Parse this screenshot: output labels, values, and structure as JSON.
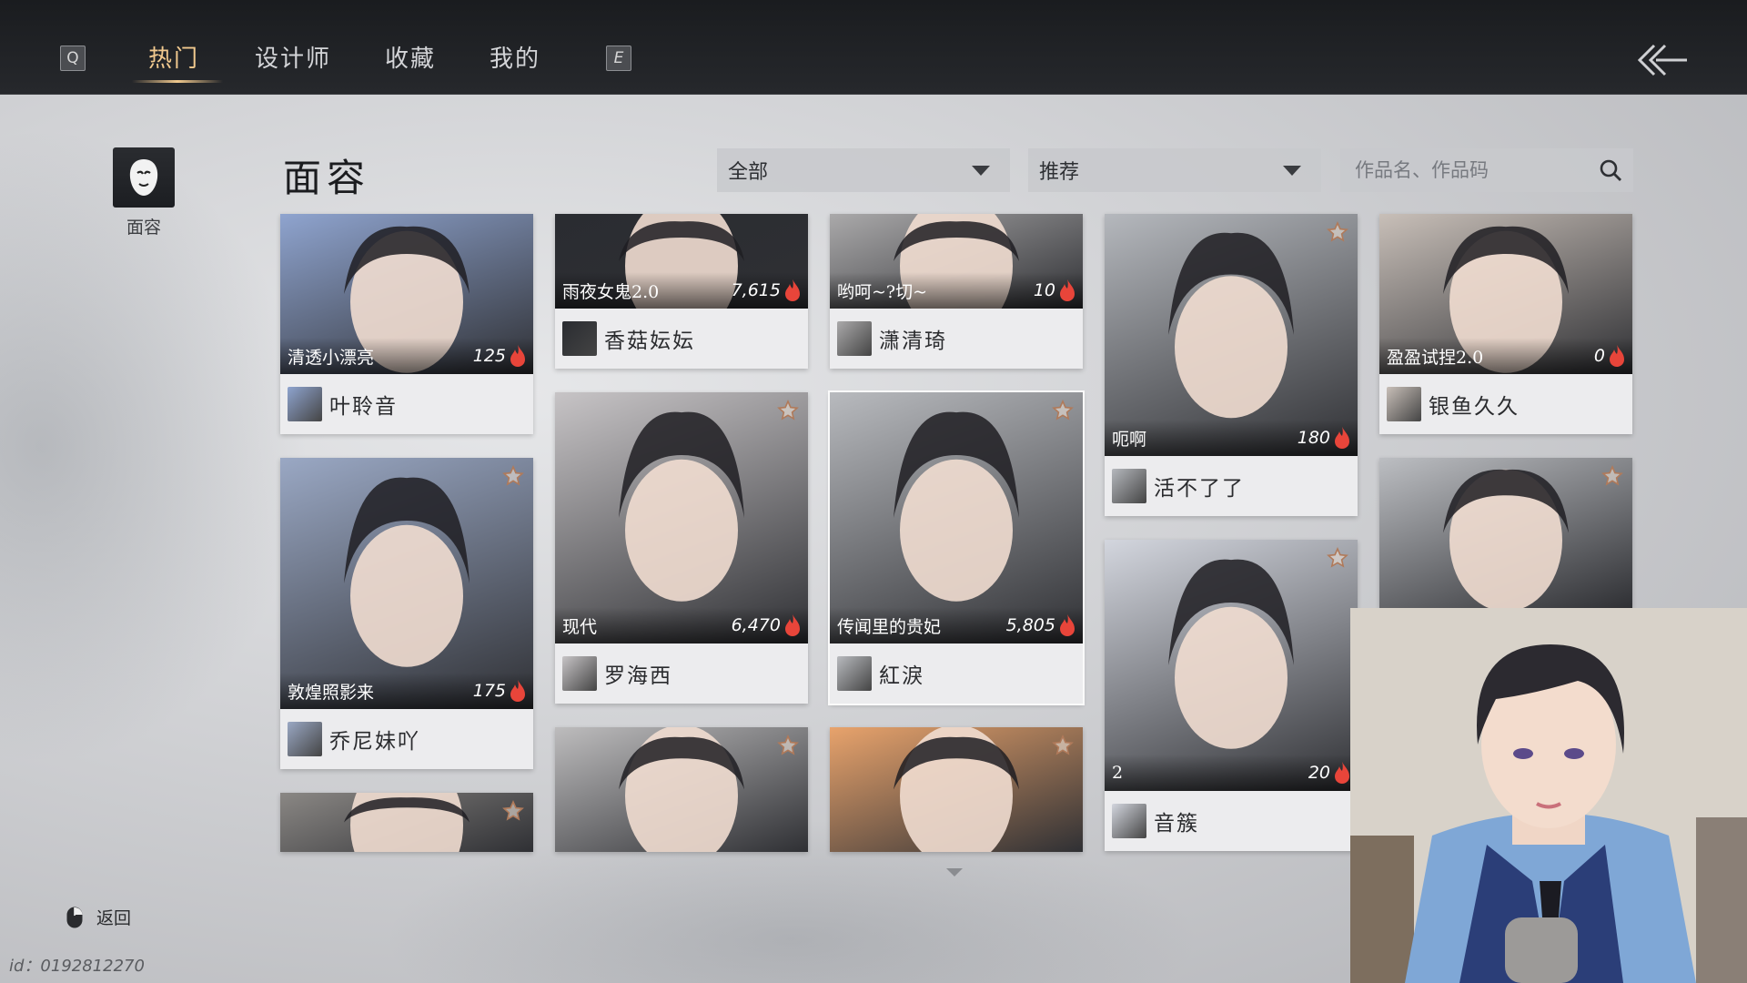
{
  "top_nav": {
    "left_key": "Q",
    "right_key": "E",
    "tabs": [
      {
        "label": "热门",
        "active": true
      },
      {
        "label": "设计师",
        "active": false
      },
      {
        "label": "收藏",
        "active": false
      },
      {
        "label": "我的",
        "active": false
      }
    ]
  },
  "sidebar": {
    "label": "面容"
  },
  "page": {
    "title": "面容"
  },
  "filters": {
    "category": "全部",
    "sort": "推荐",
    "search_placeholder": "作品名、作品码"
  },
  "cards": [
    {
      "work": "清透小漂亮",
      "count": "125",
      "author": "叶聆音",
      "favorite": false,
      "tone": "#8fa4cf"
    },
    {
      "work": "敦煌照影来",
      "count": "175",
      "author": "乔尼妹吖",
      "favorite": true,
      "tone": "#9aa8c4"
    },
    {
      "work": "",
      "count": "",
      "author": "",
      "favorite": true,
      "tone": "#8a8784"
    },
    {
      "work": "雨夜女鬼2.0",
      "count": "7,615",
      "author": "香菇妘妘",
      "favorite": false,
      "tone": "#2a2c31"
    },
    {
      "work": "现代",
      "count": "6,470",
      "author": "罗海西",
      "favorite": true,
      "tone": "#c7c4c6"
    },
    {
      "work": "",
      "count": "",
      "author": "",
      "favorite": true,
      "tone": "#bdbcbd"
    },
    {
      "work": "哟呵~?切~",
      "count": "10",
      "author": "潇清琦",
      "favorite": false,
      "tone": "#aaa9aa"
    },
    {
      "work": "传闻里的贵妃",
      "count": "5,805",
      "author": "紅淚",
      "favorite": true,
      "tone": "#b8babe"
    },
    {
      "work": "",
      "count": "",
      "author": "",
      "favorite": true,
      "tone": "#e8a36c"
    },
    {
      "work": "呃啊",
      "count": "180",
      "author": "活不了了",
      "favorite": true,
      "tone": "#b5b8bd"
    },
    {
      "work": "2",
      "count": "20",
      "author": "音簇",
      "favorite": true,
      "tone": "#d3d6de"
    },
    {
      "work": "盈盈试捏2.0",
      "count": "0",
      "author": "银鱼久久",
      "favorite": false,
      "tone": "#c8bfb8"
    },
    {
      "work": "",
      "count": "",
      "author": "",
      "favorite": true,
      "tone": "#bcbec2"
    }
  ],
  "footer": {
    "back_label": "返回",
    "user_id": "id：0192812270"
  },
  "colors": {
    "accent": "#f1c98e",
    "flame": "#e8453a",
    "topbar": "#1f2124"
  }
}
